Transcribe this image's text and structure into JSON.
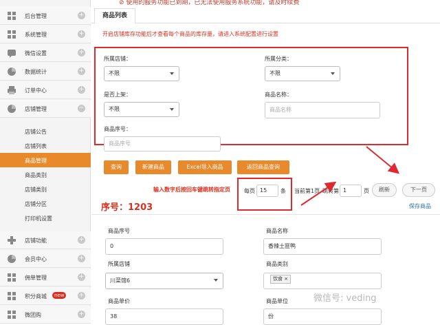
{
  "top_warning": "⊘ 使用的服务功能已到期，已无法使用服务系统功能，请及时续费",
  "sidebar": {
    "items": [
      {
        "label": "后台管理",
        "icon": "grid-icon"
      },
      {
        "label": "系统管理",
        "icon": "grid-icon"
      },
      {
        "label": "微信设置",
        "icon": "chat-icon"
      },
      {
        "label": "数据统计",
        "icon": "pie-chart-icon"
      },
      {
        "label": "订单中心",
        "icon": "printer-icon"
      },
      {
        "label": "店铺管理",
        "icon": "pie-chart-icon"
      }
    ],
    "sub_items": [
      "店铺公告",
      "店铺列表",
      "商品管理",
      "商品类别",
      "店铺类别",
      "店铺分区",
      "打印机设置"
    ],
    "items_after": [
      {
        "label": "店铺功能",
        "icon": "plus-icon"
      },
      {
        "label": "会员中心",
        "icon": "pie-chart-icon"
      },
      {
        "label": "佣单管理",
        "icon": "grid-icon"
      },
      {
        "label": "积分商城",
        "icon": "grid-icon",
        "badge": "new"
      },
      {
        "label": "微团购",
        "icon": "grid-icon"
      }
    ]
  },
  "tab": {
    "label": "商品列表"
  },
  "notice": "开启店铺库存功能后才查看每个商品的库存量，请进入系统配置进行设置",
  "filters": {
    "store_label": "所属店铺：",
    "store_value": "不限",
    "category_label": "所属分类：",
    "category_value": "不限",
    "shelf_label": "是否上架：",
    "shelf_value": "不限",
    "name_label": "商品名称：",
    "name_placeholder": "商品名称",
    "serial_label": "商品序号：",
    "serial_placeholder": "商品序号"
  },
  "buttons": {
    "query": "查询",
    "new_product": "新建商品",
    "excel_import": "Excel导入商品",
    "return_query": "返回商品查询"
  },
  "pagination": {
    "hint": "输入数字后按回车键跳转指定页",
    "per_page_label": "每页",
    "per_page_value": "15",
    "per_page_unit": "条",
    "current_page": "当前第1页",
    "goto_label": "跳转第",
    "goto_value": "1",
    "goto_unit": "页",
    "refresh": "刷新",
    "next": "下一页"
  },
  "serial_annotation": "序号：1203",
  "save_link": "保存商品",
  "form": {
    "serial_label": "商品序号",
    "serial_value": "0",
    "name_label": "商品名称",
    "name_value": "香辣土匪鸭",
    "store_label": "所属店铺",
    "store_value": "川菜馆6",
    "category_label": "商品类别",
    "category_tag": "饮食 ×",
    "price_label": "商品单价",
    "price_value": "38",
    "unit_label": "商品单位",
    "unit_value": "份"
  },
  "watermark": "微信号: veding",
  "colors": {
    "accent": "#e8892b",
    "highlight_red": "#e0282f",
    "link": "#2a6fb8"
  }
}
